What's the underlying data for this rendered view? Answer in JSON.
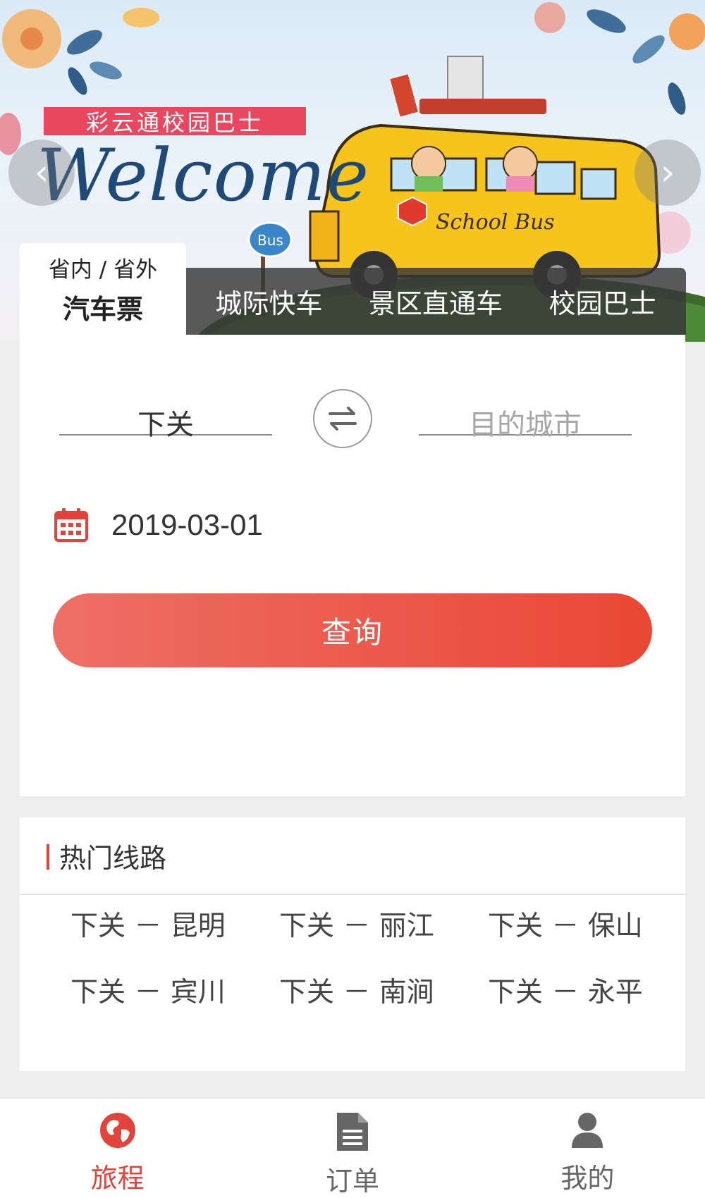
{
  "banner": {
    "tag": "彩云通校园巴士",
    "welcome": "Welcome",
    "bus_text": "School Bus",
    "sign_text": "Bus",
    "prev_icon": "chevron-left-icon",
    "next_icon": "chevron-right-icon"
  },
  "tabs": {
    "active": {
      "sub": "省内 / 省外",
      "main": "汽车票"
    },
    "items": [
      {
        "label": "城际快车"
      },
      {
        "label": "景区直通车"
      },
      {
        "label": "校园巴士"
      }
    ]
  },
  "search": {
    "from_city": "下关",
    "to_placeholder": "目的城市",
    "swap_icon": "swap-arrows-icon",
    "calendar_icon": "calendar-icon",
    "date": "2019-03-01",
    "query_label": "查询"
  },
  "hot_routes": {
    "title": "热门线路",
    "routes": [
      "下关 － 昆明",
      "下关 － 丽江",
      "下关 － 保山",
      "下关 － 宾川",
      "下关 － 南涧",
      "下关 － 永平"
    ]
  },
  "bottom_nav": {
    "items": [
      {
        "label": "旅程",
        "icon": "globe-icon",
        "active": true
      },
      {
        "label": "订单",
        "icon": "document-icon",
        "active": false
      },
      {
        "label": "我的",
        "icon": "user-icon",
        "active": false
      }
    ]
  },
  "colors": {
    "accent": "#e0443a",
    "tag_pink": "#e8475f",
    "welcome_blue": "#1f4a78",
    "tab_bar_bg": "#373737"
  }
}
